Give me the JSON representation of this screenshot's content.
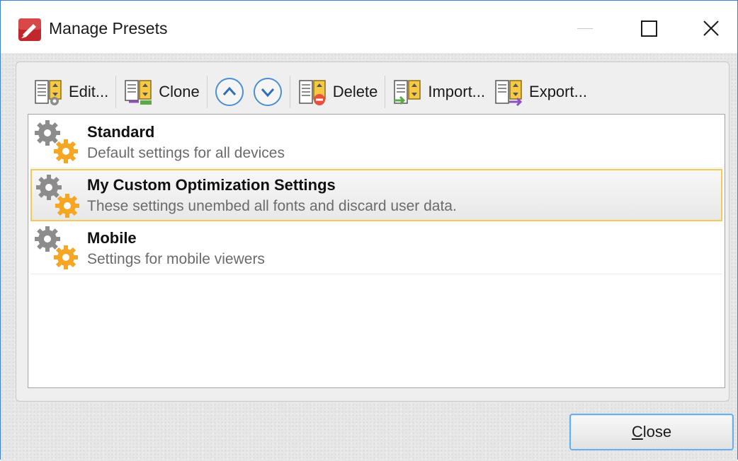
{
  "window": {
    "title": "Manage Presets"
  },
  "toolbar": {
    "edit_label": "Edit...",
    "clone_label": "Clone",
    "move_up_icon": "chevron-up-circle-icon",
    "move_down_icon": "chevron-down-circle-icon",
    "delete_label": "Delete",
    "import_label": "Import...",
    "export_label": "Export..."
  },
  "presets": [
    {
      "name": "Standard",
      "description": "Default settings for all devices",
      "selected": false
    },
    {
      "name": "My Custom Optimization Settings",
      "description": "These settings unembed all fonts and discard user data.",
      "selected": true
    },
    {
      "name": "Mobile",
      "description": "Settings for mobile viewers",
      "selected": false
    }
  ],
  "footer": {
    "close_first": "C",
    "close_rest": "lose"
  },
  "colors": {
    "accent": "#3c7fd4",
    "selection_border": "#f2c95a",
    "gear_gray": "#8c8c8c",
    "gear_orange": "#f5a623",
    "doc_yellow": "#f6c945"
  }
}
